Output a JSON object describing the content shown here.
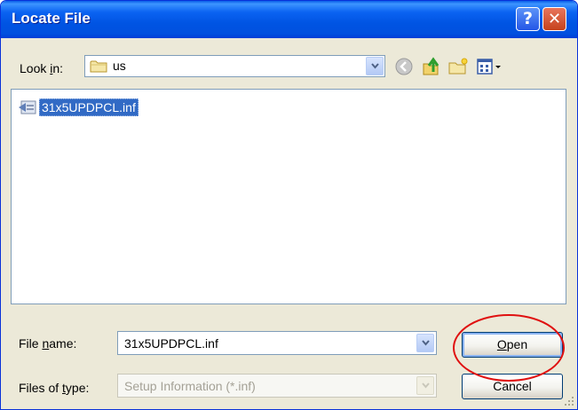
{
  "window": {
    "title": "Locate File",
    "help_glyph": "?",
    "close_glyph": "✕"
  },
  "lookin": {
    "label_prefix": "Look ",
    "label_mnemonic": "i",
    "label_suffix": "n:",
    "value": "us"
  },
  "toolbar": {
    "icons": [
      "back-arrow-icon",
      "up-one-level-icon",
      "new-folder-icon",
      "view-menu-icon"
    ]
  },
  "files": [
    {
      "name": "31x5UPDPCL.inf",
      "icon": "setup-information-file-icon",
      "selected": true
    }
  ],
  "filename": {
    "label_prefix": "File ",
    "label_mnemonic": "n",
    "label_suffix": "ame:",
    "value": "31x5UPDPCL.inf"
  },
  "filetype": {
    "label_prefix": "Files of ",
    "label_mnemonic": "t",
    "label_suffix": "ype:",
    "value": "Setup Information (*.inf)"
  },
  "buttons": {
    "open_mnemonic": "O",
    "open_rest": "pen",
    "cancel": "Cancel"
  },
  "colors": {
    "titlebar": "#0054e3",
    "dialog_bg": "#ece9d8",
    "selection": "#316ac5",
    "annotation": "#e01010"
  }
}
